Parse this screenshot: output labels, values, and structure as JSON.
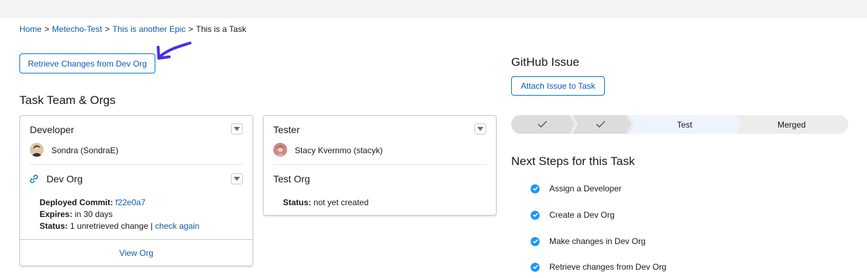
{
  "breadcrumb": {
    "home": "Home",
    "project": "Metecho-Test",
    "epic": "This is another Epic",
    "task": "This is a Task",
    "separator": ">"
  },
  "actions": {
    "retrieve_label": "Retrieve Changes from Dev Org",
    "attach_label": "Attach Issue to Task"
  },
  "team": {
    "heading": "Task Team & Orgs",
    "developer": {
      "title": "Developer",
      "person": "Sondra (SondraE)",
      "org": {
        "title": "Dev Org",
        "commit_label": "Deployed Commit:",
        "commit_value": "f22e0a7",
        "expires_label": "Expires:",
        "expires_value": "in 30 days",
        "status_label": "Status:",
        "status_value": "1 unretrieved change |",
        "check_link": "check again",
        "view_link": "View Org"
      }
    },
    "tester": {
      "title": "Tester",
      "person": "Stacy Kvernmo (stacyk)",
      "org": {
        "title": "Test Org",
        "status_label": "Status:",
        "status_value": "not yet created"
      }
    }
  },
  "github": {
    "heading": "GitHub Issue"
  },
  "path": {
    "stages": [
      {
        "label": "",
        "state": "complete",
        "icon": "check-icon"
      },
      {
        "label": "",
        "state": "complete",
        "icon": "check-icon"
      },
      {
        "label": "Test",
        "state": "current"
      },
      {
        "label": "Merged",
        "state": "incomplete"
      }
    ]
  },
  "steps": {
    "heading": "Next Steps for this Task",
    "items": [
      {
        "label": "Assign a Developer",
        "done": true
      },
      {
        "label": "Create a Dev Org",
        "done": true
      },
      {
        "label": "Make changes in Dev Org",
        "done": true
      },
      {
        "label": "Retrieve changes from Dev Org",
        "done": true
      }
    ]
  },
  "colors": {
    "brand": "#0176d3",
    "link": "#0b5cab",
    "check": "#1b96ff",
    "arrow": "#4b2bea",
    "path_complete": "#dcdcdc",
    "path_current": "#eef4ff",
    "path_incomplete": "#ececec"
  }
}
